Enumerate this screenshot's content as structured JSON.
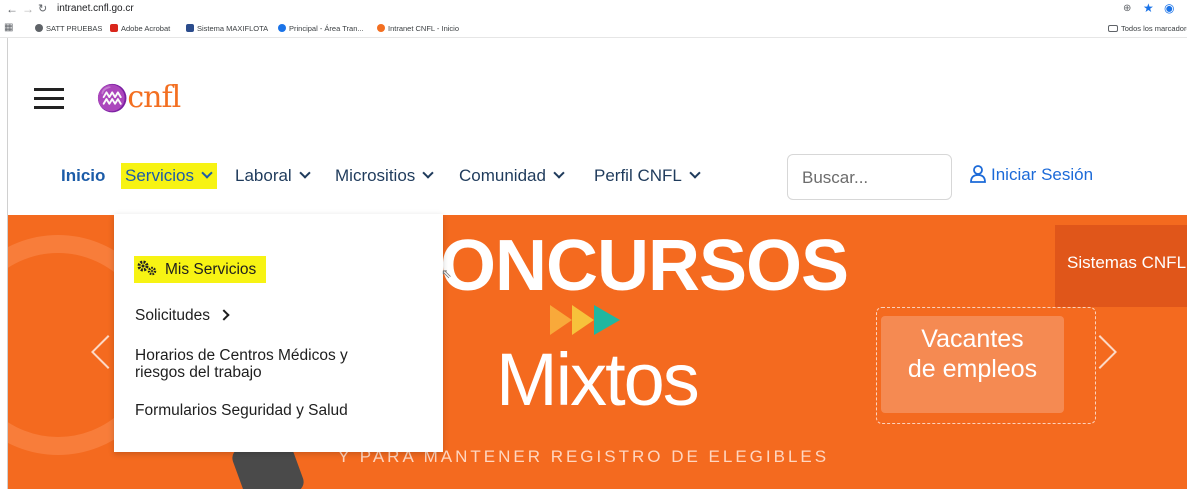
{
  "browser": {
    "url": "intranet.cnfl.go.cr",
    "bookmarks": [
      {
        "label": "SATT PRUEBAS",
        "color": "#5f6368"
      },
      {
        "label": "Adobe Acrobat",
        "color": "#d9261c"
      },
      {
        "label": "Sistema MAXIFLOTA",
        "color": "#2b4c8c"
      },
      {
        "label": "Principal - Área Tran...",
        "color": "#1a73e8"
      },
      {
        "label": "Intranet CNFL - Inicio",
        "color": "#f36f21"
      }
    ],
    "all_bookmarks": "Todos los marcadores"
  },
  "header": {
    "logo_text": "cnfl"
  },
  "nav": {
    "items": [
      "Inicio",
      "Servicios",
      "Laboral",
      "Micrositios",
      "Comunidad",
      "Perfil CNFL"
    ],
    "search_placeholder": "Buscar...",
    "login": "Iniciar Sesión"
  },
  "dropdown": {
    "items": [
      "Mis Servicios",
      "Solicitudes",
      "Horarios de Centros Médicos y riesgos del trabajo",
      "Formularios Seguridad y Salud"
    ]
  },
  "hero": {
    "title": "ONCURSOS",
    "subtitle": "Mixtos",
    "tagline": "Y PARA MANTENER REGISTRO DE ELEGIBLES",
    "vacantes_line1": "Vacantes",
    "vacantes_line2": "de empleos",
    "sistemas": "Sistemas CNFL"
  },
  "colors": {
    "brand_orange": "#f36f21",
    "highlight_yellow": "#f7f313",
    "nav_blue": "#1c5ca8"
  }
}
